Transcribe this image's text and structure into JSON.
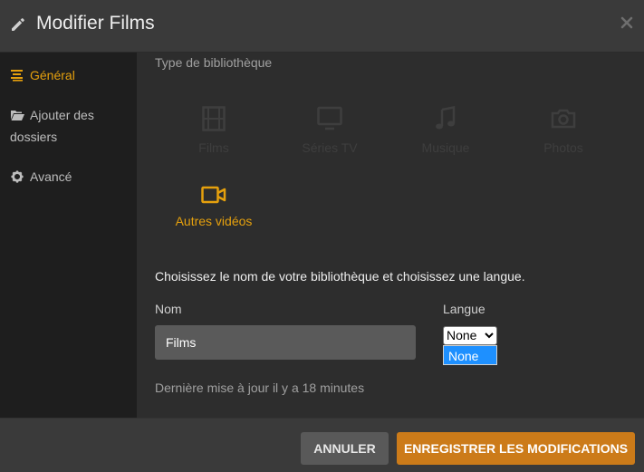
{
  "header": {
    "title": "Modifier Films",
    "edit_icon": "pencil-icon",
    "close_icon": "close-icon"
  },
  "sidebar": {
    "items": [
      {
        "label": "Général",
        "icon": "list-icon",
        "active": true
      },
      {
        "label": "Ajouter des dossiers",
        "icon": "folder-open-icon",
        "active": false
      },
      {
        "label": "Avancé",
        "icon": "gear-icon",
        "active": false
      }
    ]
  },
  "main": {
    "library_type_label": "Type de bibliothèque",
    "library_types": [
      {
        "label": "Films",
        "icon": "film-icon",
        "selected": false
      },
      {
        "label": "Séries TV",
        "icon": "tv-icon",
        "selected": false
      },
      {
        "label": "Musique",
        "icon": "music-icon",
        "selected": false
      },
      {
        "label": "Photos",
        "icon": "camera-icon",
        "selected": false
      },
      {
        "label": "Autres vidéos",
        "icon": "video-camera-icon",
        "selected": true
      }
    ],
    "instructions": "Choisissez le nom de votre bibliothèque et choisissez une langue.",
    "name_label": "Nom",
    "name_value": "Films",
    "language_label": "Langue",
    "language_selected": "None",
    "language_options": [
      "None"
    ],
    "last_update": "Dernière mise à jour il y a 18 minutes"
  },
  "footer": {
    "cancel_label": "ANNULER",
    "save_label": "ENREGISTRER LES MODIFICATIONS"
  },
  "colors": {
    "accent": "#e5a00d",
    "save_button": "#cc7b19",
    "cancel_button": "#595959",
    "highlight_option": "#1e90ff"
  }
}
